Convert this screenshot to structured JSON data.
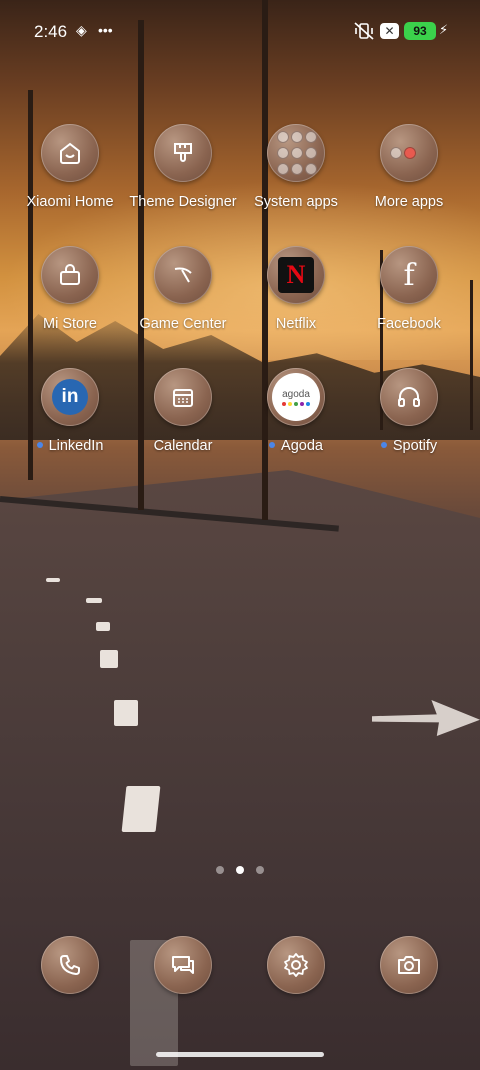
{
  "status_bar": {
    "time": "2:46",
    "battery": "93",
    "icons": [
      "nfc-icon",
      "more-dots-icon",
      "vibrate-icon",
      "close-box-icon",
      "battery-icon",
      "charging-icon"
    ]
  },
  "apps": [
    {
      "label": "Xiaomi Home",
      "icon": "xiaomi-home-icon",
      "new": false
    },
    {
      "label": "Theme Designer",
      "icon": "brush-icon",
      "new": false
    },
    {
      "label": "System apps",
      "icon": "folder-icon",
      "new": false
    },
    {
      "label": "More apps",
      "icon": "folder-icon",
      "new": false
    },
    {
      "label": "Mi Store",
      "icon": "bag-icon",
      "new": false
    },
    {
      "label": "Game Center",
      "icon": "game-center-icon",
      "new": false
    },
    {
      "label": "Netflix",
      "icon": "netflix-icon",
      "new": false
    },
    {
      "label": "Facebook",
      "icon": "facebook-icon",
      "new": false
    },
    {
      "label": "LinkedIn",
      "icon": "linkedin-icon",
      "new": true
    },
    {
      "label": "Calendar",
      "icon": "calendar-icon",
      "new": false
    },
    {
      "label": "Agoda",
      "icon": "agoda-icon",
      "new": true
    },
    {
      "label": "Spotify",
      "icon": "headphones-icon",
      "new": true
    }
  ],
  "icon_text": {
    "netflix": "N",
    "linkedin": "in",
    "facebook": "f",
    "agoda": "agoda"
  },
  "pager": {
    "pages": 3,
    "active_page": 2
  },
  "dock": [
    {
      "icon": "phone-icon"
    },
    {
      "icon": "messages-icon"
    },
    {
      "icon": "settings-icon"
    },
    {
      "icon": "camera-icon"
    }
  ],
  "colors": {
    "battery": "#3bd14b",
    "new_dot": "#4b86e8",
    "netflix_red": "#e50914",
    "linkedin_blue": "#2867b2"
  }
}
